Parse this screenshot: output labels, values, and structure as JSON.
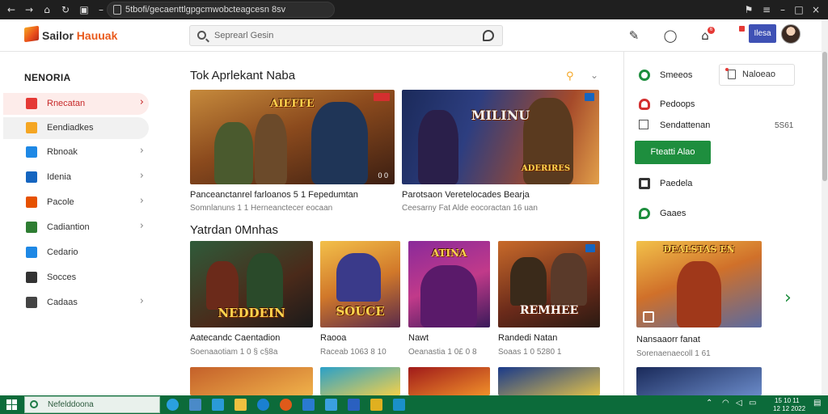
{
  "browser": {
    "url": "5tbofi/gecaenttlgpgcmwobcteagcesn 8sv"
  },
  "header": {
    "logo_text_main": "Sailor",
    "logo_text_accent": "Hauuak",
    "search_placeholder": "Seprearl Gesin",
    "notification_count": "6",
    "lang_label": "Ilesa"
  },
  "sidebar": {
    "title": "NENORIA",
    "items": [
      {
        "label": "Rnecatan",
        "icon": "flag-icon",
        "color": "#e53935",
        "active": true,
        "chevron": true
      },
      {
        "label": "Eendiadkes",
        "icon": "grid-icon",
        "color": "#f5a623",
        "active": false,
        "chevron": false
      },
      {
        "label": "Rbnoak",
        "icon": "windows-icon",
        "color": "#1e88e5",
        "active": false,
        "chevron": true
      },
      {
        "label": "Idenia",
        "icon": "pen-icon",
        "color": "#1565c0",
        "active": false,
        "chevron": true
      },
      {
        "label": "Pacole",
        "icon": "globe-icon",
        "color": "#e65100",
        "active": false,
        "chevron": true
      },
      {
        "label": "Cadiantion",
        "icon": "puzzle-icon",
        "color": "#2e7d32",
        "active": false,
        "chevron": true
      },
      {
        "label": "Cedario",
        "icon": "star-icon",
        "color": "#1e88e5",
        "active": false,
        "chevron": false
      },
      {
        "label": "Socces",
        "icon": "shield-icon",
        "color": "#333333",
        "active": false,
        "chevron": false
      },
      {
        "label": "Cadaas",
        "icon": "monitor-icon",
        "color": "#444444",
        "active": false,
        "chevron": true
      }
    ]
  },
  "main": {
    "section1_title": "Tok Aprlekant Naba",
    "featured": [
      {
        "title": "Panceanctanrel farloanos 5 1 Fepedumtan",
        "sub": "Somnlanuns 1 1 Herneanctecer eocaan",
        "art_title": "AIEFFE",
        "corner": "0 0"
      },
      {
        "title": "Parotsaon Veretelocades Bearja",
        "sub": "Ceesarny Fat Alde eocoractan 16 uan",
        "art_title": "MILINU",
        "banner": "ADERIRES"
      }
    ],
    "section2_title": "Yatrdan 0Mnhas",
    "grid": [
      {
        "title": "Aatecandc Caentadion",
        "sub": "Soenaaotiam 1 0 § c§8a",
        "art_title": "NEDDEIN"
      },
      {
        "title": "Raooa",
        "sub": "Raceab 1063 8 10",
        "art_title": "SOUCE"
      },
      {
        "title": "Nawt",
        "sub": "Oeanastia 1 0£ 0 8",
        "art_title": "ATINA"
      },
      {
        "title": "Randedi Natan",
        "sub": "Soaas 1 0 5280 1",
        "art_title": "REMHEE"
      }
    ]
  },
  "right_panel": {
    "items": [
      {
        "label": "Smeeos",
        "icon": "search-icon"
      },
      {
        "label": "Pedoops",
        "icon": "gamepad-icon"
      },
      {
        "label": "Sendattenan",
        "icon": "calendar-icon"
      },
      {
        "label": "Paedela",
        "icon": "box-icon"
      },
      {
        "label": "Gaaes",
        "icon": "chat-icon"
      }
    ],
    "notice_label": "Naloeao",
    "count_text": "5S61",
    "green_button": "Fteatti Alao",
    "featured_title": "Nansaaorr fanat",
    "featured_sub": "Sorenaenaecoll 1 61",
    "featured_art": "DEALSTAS EN"
  },
  "taskbar": {
    "search_text": "Nefelddoona",
    "time": "15 10 11",
    "date": "12 12 2022"
  },
  "colors": {
    "accent_green": "#1e8e3e",
    "taskbar_green": "#0c6b3a",
    "brand_orange": "#e95a1c",
    "active_red": "#e53935"
  }
}
